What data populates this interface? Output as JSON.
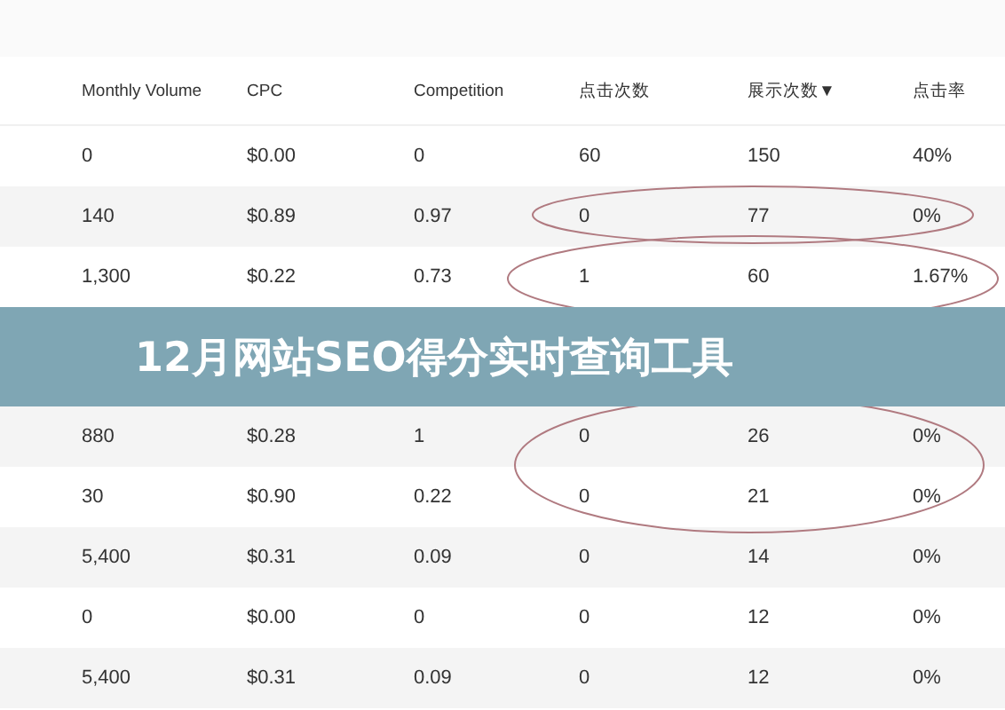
{
  "banner": {
    "title": "12月网站SEO得分实时查询工具"
  },
  "table": {
    "columns": [
      "Monthly Volume",
      "CPC",
      "Competition",
      "点击次数",
      "展示次数▼",
      "点击率"
    ],
    "rows": [
      [
        "0",
        "$0.00",
        "0",
        "60",
        "150",
        "40%"
      ],
      [
        "140",
        "$0.89",
        "0.97",
        "0",
        "77",
        "0%"
      ],
      [
        "1,300",
        "$0.22",
        "0.73",
        "1",
        "60",
        "1.67%"
      ],
      [
        "880",
        "$0.28",
        "1",
        "0",
        "26",
        "0%"
      ],
      [
        "30",
        "$0.90",
        "0.22",
        "0",
        "21",
        "0%"
      ],
      [
        "5,400",
        "$0.31",
        "0.09",
        "0",
        "14",
        "0%"
      ],
      [
        "0",
        "$0.00",
        "0",
        "0",
        "12",
        "0%"
      ],
      [
        "5,400",
        "$0.31",
        "0.09",
        "0",
        "12",
        "0%"
      ]
    ]
  }
}
